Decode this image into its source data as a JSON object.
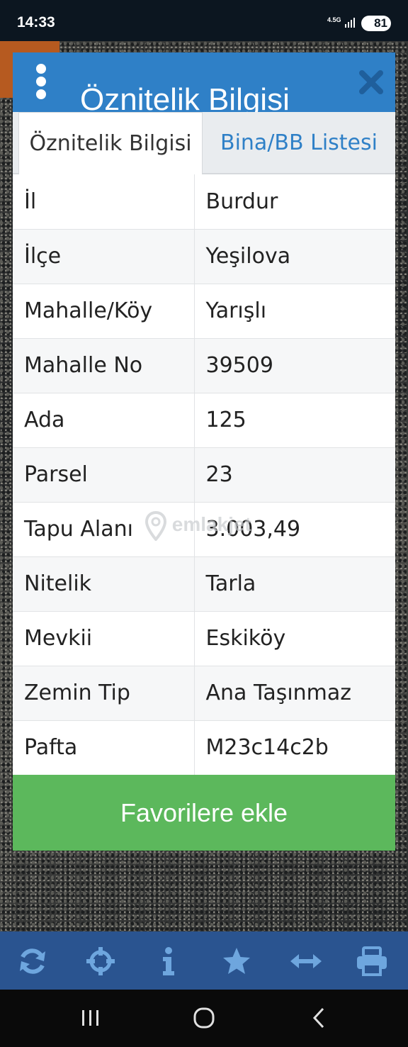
{
  "status_bar": {
    "time": "14:33",
    "network": "4.5G",
    "battery": "81"
  },
  "dialog": {
    "title": "Öznitelik Bilgisi",
    "tabs": [
      {
        "label": "Öznitelik Bilgisi",
        "active": true
      },
      {
        "label": "Bina/BB Listesi",
        "active": false
      }
    ],
    "rows": [
      {
        "key": "İl",
        "value": "Burdur"
      },
      {
        "key": "İlçe",
        "value": "Yeşilova"
      },
      {
        "key": "Mahalle/Köy",
        "value": "Yarışlı"
      },
      {
        "key": "Mahalle No",
        "value": "39509"
      },
      {
        "key": "Ada",
        "value": "125"
      },
      {
        "key": "Parsel",
        "value": "23"
      },
      {
        "key": "Tapu Alanı",
        "value": "3.003,49"
      },
      {
        "key": "Nitelik",
        "value": "Tarla"
      },
      {
        "key": "Mevkii",
        "value": "Eskiköy"
      },
      {
        "key": "Zemin Tip",
        "value": "Ana Taşınmaz"
      },
      {
        "key": "Pafta",
        "value": "M23c14c2b"
      }
    ],
    "favorite_button": "Favorilere ekle"
  },
  "watermark": "emlakjet",
  "toolbar": {
    "icons": [
      "refresh-icon",
      "crosshair-icon",
      "info-icon",
      "star-icon",
      "measure-icon",
      "print-icon"
    ]
  },
  "colors": {
    "header": "#2f80c7",
    "favorite": "#5cb85c",
    "toolbar": "#2a5490",
    "toolbar_icon": "#6ea6de"
  }
}
